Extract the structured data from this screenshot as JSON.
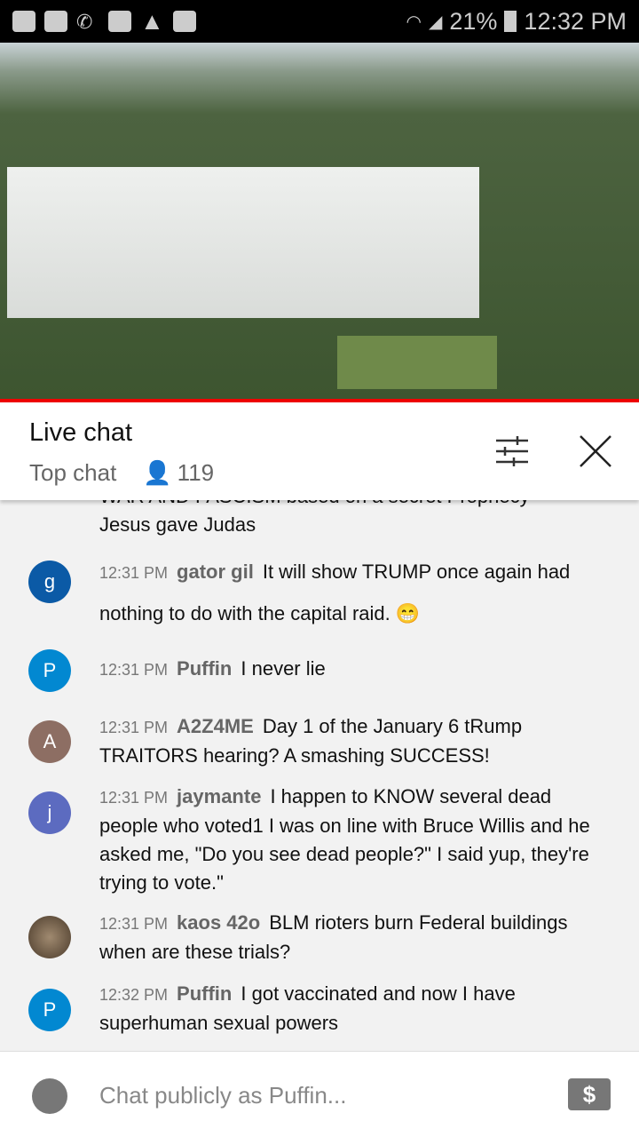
{
  "status_bar": {
    "battery": "21%",
    "time": "12:32 PM",
    "icons": [
      "app-icon",
      "youtube-icon",
      "missed-call-icon",
      "folder-icon",
      "warning-icon",
      "image-icon",
      "wifi-icon",
      "signal-icon",
      "battery-icon"
    ]
  },
  "header": {
    "title": "Live chat",
    "mode": "Top chat",
    "viewers": "119",
    "icons": [
      "filter-icon",
      "close-icon"
    ]
  },
  "messages": [
    {
      "time": "",
      "author": "",
      "text": "WAR AND FASCISM based on a secret Prophecy Jesus gave Judas",
      "avatar": "",
      "color": ""
    },
    {
      "time": "12:31 PM",
      "author": "gator gil",
      "text": "It will show TRUMP once again had nothing to do with the capital raid. 😁",
      "avatar": "g",
      "color": "#0b5aa6"
    },
    {
      "time": "12:31 PM",
      "author": "Puffin",
      "text": "I never lie",
      "avatar": "P",
      "color": "#0288d1"
    },
    {
      "time": "12:31 PM",
      "author": "A2Z4ME",
      "text": "Day 1 of the January 6 tRump TRAITORS hearing? A smashing SUCCESS!",
      "avatar": "A",
      "color": "#8d6e63"
    },
    {
      "time": "12:31 PM",
      "author": "jaymante",
      "text": "I happen to KNOW several dead people who voted1 I was on line with Bruce Willis and he asked me, \"Do you see dead people?\" I said yup, they're trying to vote.\"",
      "avatar": "j",
      "color": "#5c6bc0"
    },
    {
      "time": "12:31 PM",
      "author": "kaos 42o",
      "text": "BLM rioters burn Federal buildings when are these trials?",
      "avatar": "",
      "color": "#6b5a4a"
    },
    {
      "time": "12:32 PM",
      "author": "Puffin",
      "text": "I got vaccinated and now I have superhuman sexual powers",
      "avatar": "P",
      "color": "#0288d1"
    }
  ],
  "input": {
    "placeholder": "Chat publicly as Puffin...",
    "money_symbol": "$"
  }
}
